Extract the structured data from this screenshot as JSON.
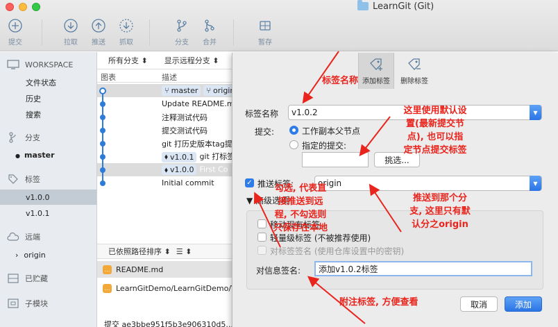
{
  "window": {
    "title": "LearnGit (Git)"
  },
  "toolbar": {
    "commit": "提交",
    "pull": "拉取",
    "push": "推送",
    "fetch": "抓取",
    "branch": "分支",
    "merge": "合并",
    "stash": "暂存"
  },
  "sidebar": {
    "workspace": "WORKSPACE",
    "workspace_items": [
      "文件状态",
      "历史",
      "搜索"
    ],
    "branches": "分支",
    "branch_items": [
      "master"
    ],
    "tags": "标签",
    "tag_items": [
      "v1.0.0",
      "v1.0.1"
    ],
    "remotes": "远端",
    "remote_items": [
      "origin"
    ],
    "stashes": "已贮藏",
    "submodules": "子模块"
  },
  "main": {
    "filter": {
      "all_branches": "所有分支",
      "show_remote": "显示远程分支"
    },
    "columns": {
      "graph": "图表",
      "desc": "描述"
    },
    "commits": [
      {
        "refs": [
          "master",
          "origin"
        ],
        "msg": ""
      },
      {
        "refs": [],
        "msg": "Update README.md"
      },
      {
        "refs": [],
        "msg": "注释测试代码"
      },
      {
        "refs": [],
        "msg": "提交测试代码"
      },
      {
        "refs": [],
        "msg": "git 打历史版本tag提"
      },
      {
        "refs": [
          "v1.0.1"
        ],
        "msg": "git 打标签"
      },
      {
        "refs": [
          "v1.0.0"
        ],
        "msg": "First Co"
      },
      {
        "refs": [],
        "msg": "Initial commit"
      }
    ],
    "sort_label": "已依照路径排序",
    "files": [
      "README.md",
      "LearnGitDemo/LearnGitDemo/V"
    ],
    "hash_line": "提交 ae3bbe951f5b3e906310d5..."
  },
  "dialog": {
    "tabs": {
      "add": "添加标签",
      "remove": "删除标签"
    },
    "tag_name_label": "标签名称",
    "tag_name_value": "v1.0.2",
    "commit_label": "提交:",
    "radio_working": "工作副本父节点",
    "radio_specified": "指定的提交:",
    "choose_button": "挑选...",
    "push_label": "推送标签:",
    "push_remote": "origin",
    "advanced": "高级选项",
    "move_existing": "移动现有标签",
    "lightweight": "轻量级标签 (不被推荐使用)",
    "sign_tag": "对标签签名 (使用仓库设置中的密钥)",
    "message_label": "对信息签名:",
    "message_value": "添加v1.0.2标签",
    "cancel": "取消",
    "add": "添加"
  },
  "annotations": {
    "tag_name": "标签名称",
    "default_commit": "这里使用默认设\n置(最新提交节\n点), 也可以指\n定节点提交标签",
    "push_check": "勾选, 代表直\n接推送到远\n程, 不勾选则\n只保存在本地",
    "push_remote": "推送到那个分\n支, 这里只有默\n认分之origin",
    "message": "附注标签, 方便查看"
  },
  "colors": {
    "accent": "#2f7be8",
    "annotation": "#e8241d",
    "selection": "#c3cbd5"
  }
}
